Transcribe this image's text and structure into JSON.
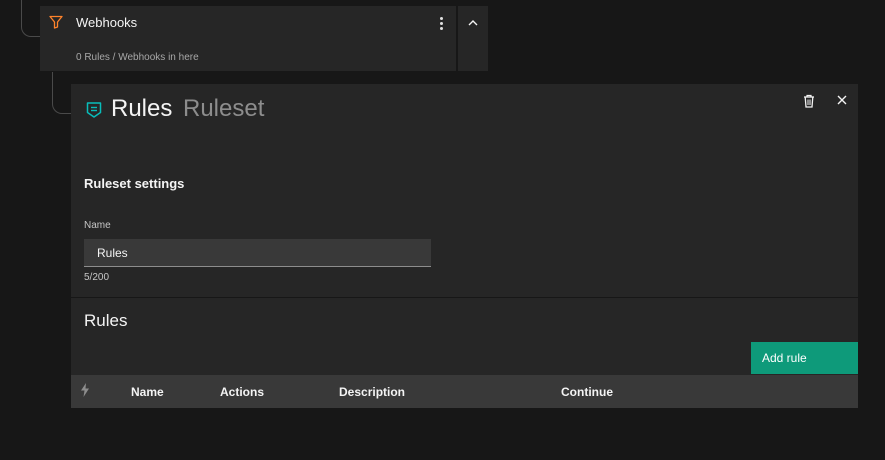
{
  "node": {
    "title": "Webhooks",
    "subtitle": "0 Rules / Webhooks in here",
    "icon": "filter-icon",
    "accent_color": "#ff832b"
  },
  "panel": {
    "title": "Rules",
    "type_label": "Ruleset",
    "icon": "ruleset-icon",
    "icon_color": "#08bdba"
  },
  "settings": {
    "heading": "Ruleset settings",
    "name_label": "Name",
    "name_value": "Rules",
    "char_count": "5/200"
  },
  "rules": {
    "heading": "Rules",
    "add_button_label": "Add rule",
    "add_button_color": "#0e9a7a",
    "columns": [
      "Name",
      "Actions",
      "Description",
      "Continue"
    ]
  }
}
